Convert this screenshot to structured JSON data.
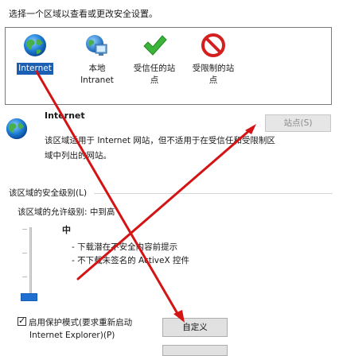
{
  "instruction": "选择一个区域以查看或更改安全设置。",
  "zones": [
    {
      "label": "Internet",
      "icon": "globe-icon",
      "selected": true
    },
    {
      "label": "本地\nIntranet",
      "icon": "intranet-icon",
      "selected": false
    },
    {
      "label": "受信任的站\n点",
      "icon": "check-icon",
      "selected": false
    },
    {
      "label": "受限制的站\n点",
      "icon": "restricted-icon",
      "selected": false
    }
  ],
  "detail": {
    "title": "Internet",
    "description": "该区域适用于 Internet 网站，但不适用于在受信任和受限制区域中列出的网站。",
    "sites_button": "站点(S)"
  },
  "security": {
    "group_title": "该区域的安全级别(L)",
    "allowed_levels": "该区域的允许级别: 中到高",
    "level_name": "中",
    "level_lines": [
      "- 下载潜在不安全内容前提示",
      "- 不下载未签名的 ActiveX 控件"
    ],
    "level_fraction": 0.25
  },
  "protected_mode": {
    "label_line1": "启用保护模式(要求重新启动",
    "label_line2": "Internet Explorer)(P)",
    "checked": true
  },
  "custom_button": "自定义",
  "colors": {
    "accent": "#1b5fb4",
    "annotation_arrow": "#d41414"
  }
}
